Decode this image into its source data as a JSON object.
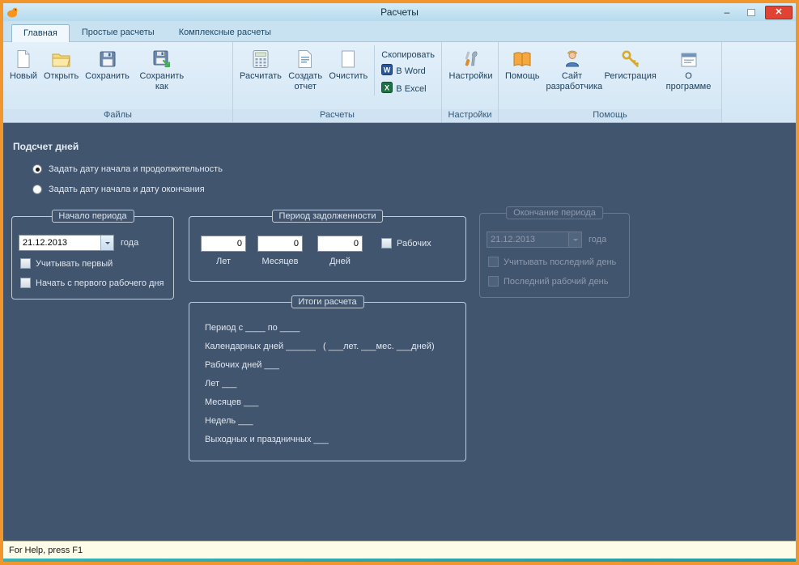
{
  "colors": {
    "window_border": "#F0962D",
    "titlebar_bg": "#C8E3F3",
    "ribbon_bg": "#D9EAF6",
    "main_bg": "#42556E",
    "close_button": "#E04334",
    "statusbar_bg": "#FDFCE9",
    "bottom_accent": "#2FA8AD"
  },
  "titlebar": {
    "title": "Расчеты",
    "minimize_icon": "–",
    "close_icon": "✕"
  },
  "tabs": [
    {
      "label": "Главная"
    },
    {
      "label": "Простые расчеты"
    },
    {
      "label": "Комплексные расчеты"
    }
  ],
  "ribbon": {
    "groups": [
      {
        "label": "Файлы"
      },
      {
        "label": "Расчеты"
      },
      {
        "label": "Настройки"
      },
      {
        "label": "Помощь"
      }
    ],
    "buttons": {
      "new": "Новый",
      "open": "Открыть",
      "save": "Сохранить",
      "save_as": "Сохранить как",
      "calculate": "Расчитать",
      "create_report": "Создать отчет",
      "clear": "Очистить",
      "copy": "Скопировать",
      "to_word": "В Word",
      "to_excel": "В Excel",
      "settings": "Настройки",
      "help": "Помощь",
      "dev_site": "Сайт разработчика",
      "registration": "Регистрация",
      "about": "О программе"
    }
  },
  "main": {
    "heading": "Подсчет дней",
    "radio_duration": "Задать дату начала и продолжительность",
    "radio_end_date": "Задать дату начала и дату окончания",
    "start_period": {
      "title": "Начало периода",
      "date": "21.12.2013",
      "year_suffix": "года",
      "cb_first": "Учитывать первый",
      "cb_first_workday": "Начать с первого рабочего дня"
    },
    "debt_period": {
      "title": "Период задолженности",
      "years_value": "0",
      "months_value": "0",
      "days_value": "0",
      "years_label": "Лет",
      "months_label": "Месяцев",
      "days_label": "Дней",
      "cb_workdays": "Рабочих"
    },
    "end_period": {
      "title": "Окончание периода",
      "date": "21.12.2013",
      "year_suffix": "года",
      "cb_last": "Учитывать последний день",
      "cb_last_workday": "Последний рабочий день"
    },
    "results": {
      "title": "Итоги расчета",
      "lines": [
        "Период с ____ по ____",
        "Календарных дней ______   ( ___лет. ___мес. ___дней)",
        "Рабочих дней ___",
        "Лет ___",
        "Месяцев ___",
        "Недель ___",
        "Выходных и праздничных ___"
      ]
    }
  },
  "statusbar": {
    "text": "For Help, press F1"
  }
}
